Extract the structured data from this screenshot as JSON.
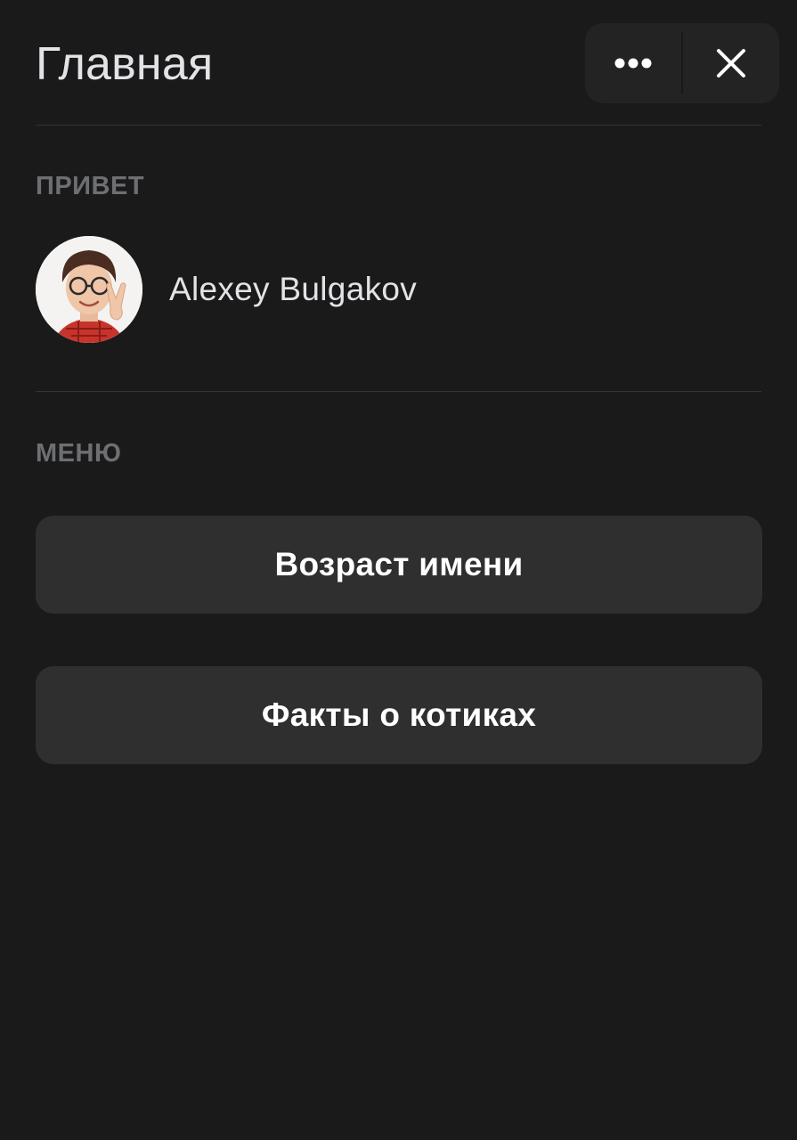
{
  "header": {
    "title": "Главная",
    "more_icon": "more-horizontal-icon",
    "close_icon": "close-icon"
  },
  "greeting": {
    "label": "ПРИВЕТ",
    "user_name": "Alexey Bulgakov"
  },
  "menu": {
    "label": "МЕНЮ",
    "items": [
      {
        "label": "Возраст имени"
      },
      {
        "label": "Факты о котиках"
      }
    ]
  },
  "colors": {
    "background": "#1a1a1a",
    "button": "#2f2f2f",
    "controls": "#232323",
    "section_label": "#6d6f73",
    "text": "#e1e3e6"
  }
}
